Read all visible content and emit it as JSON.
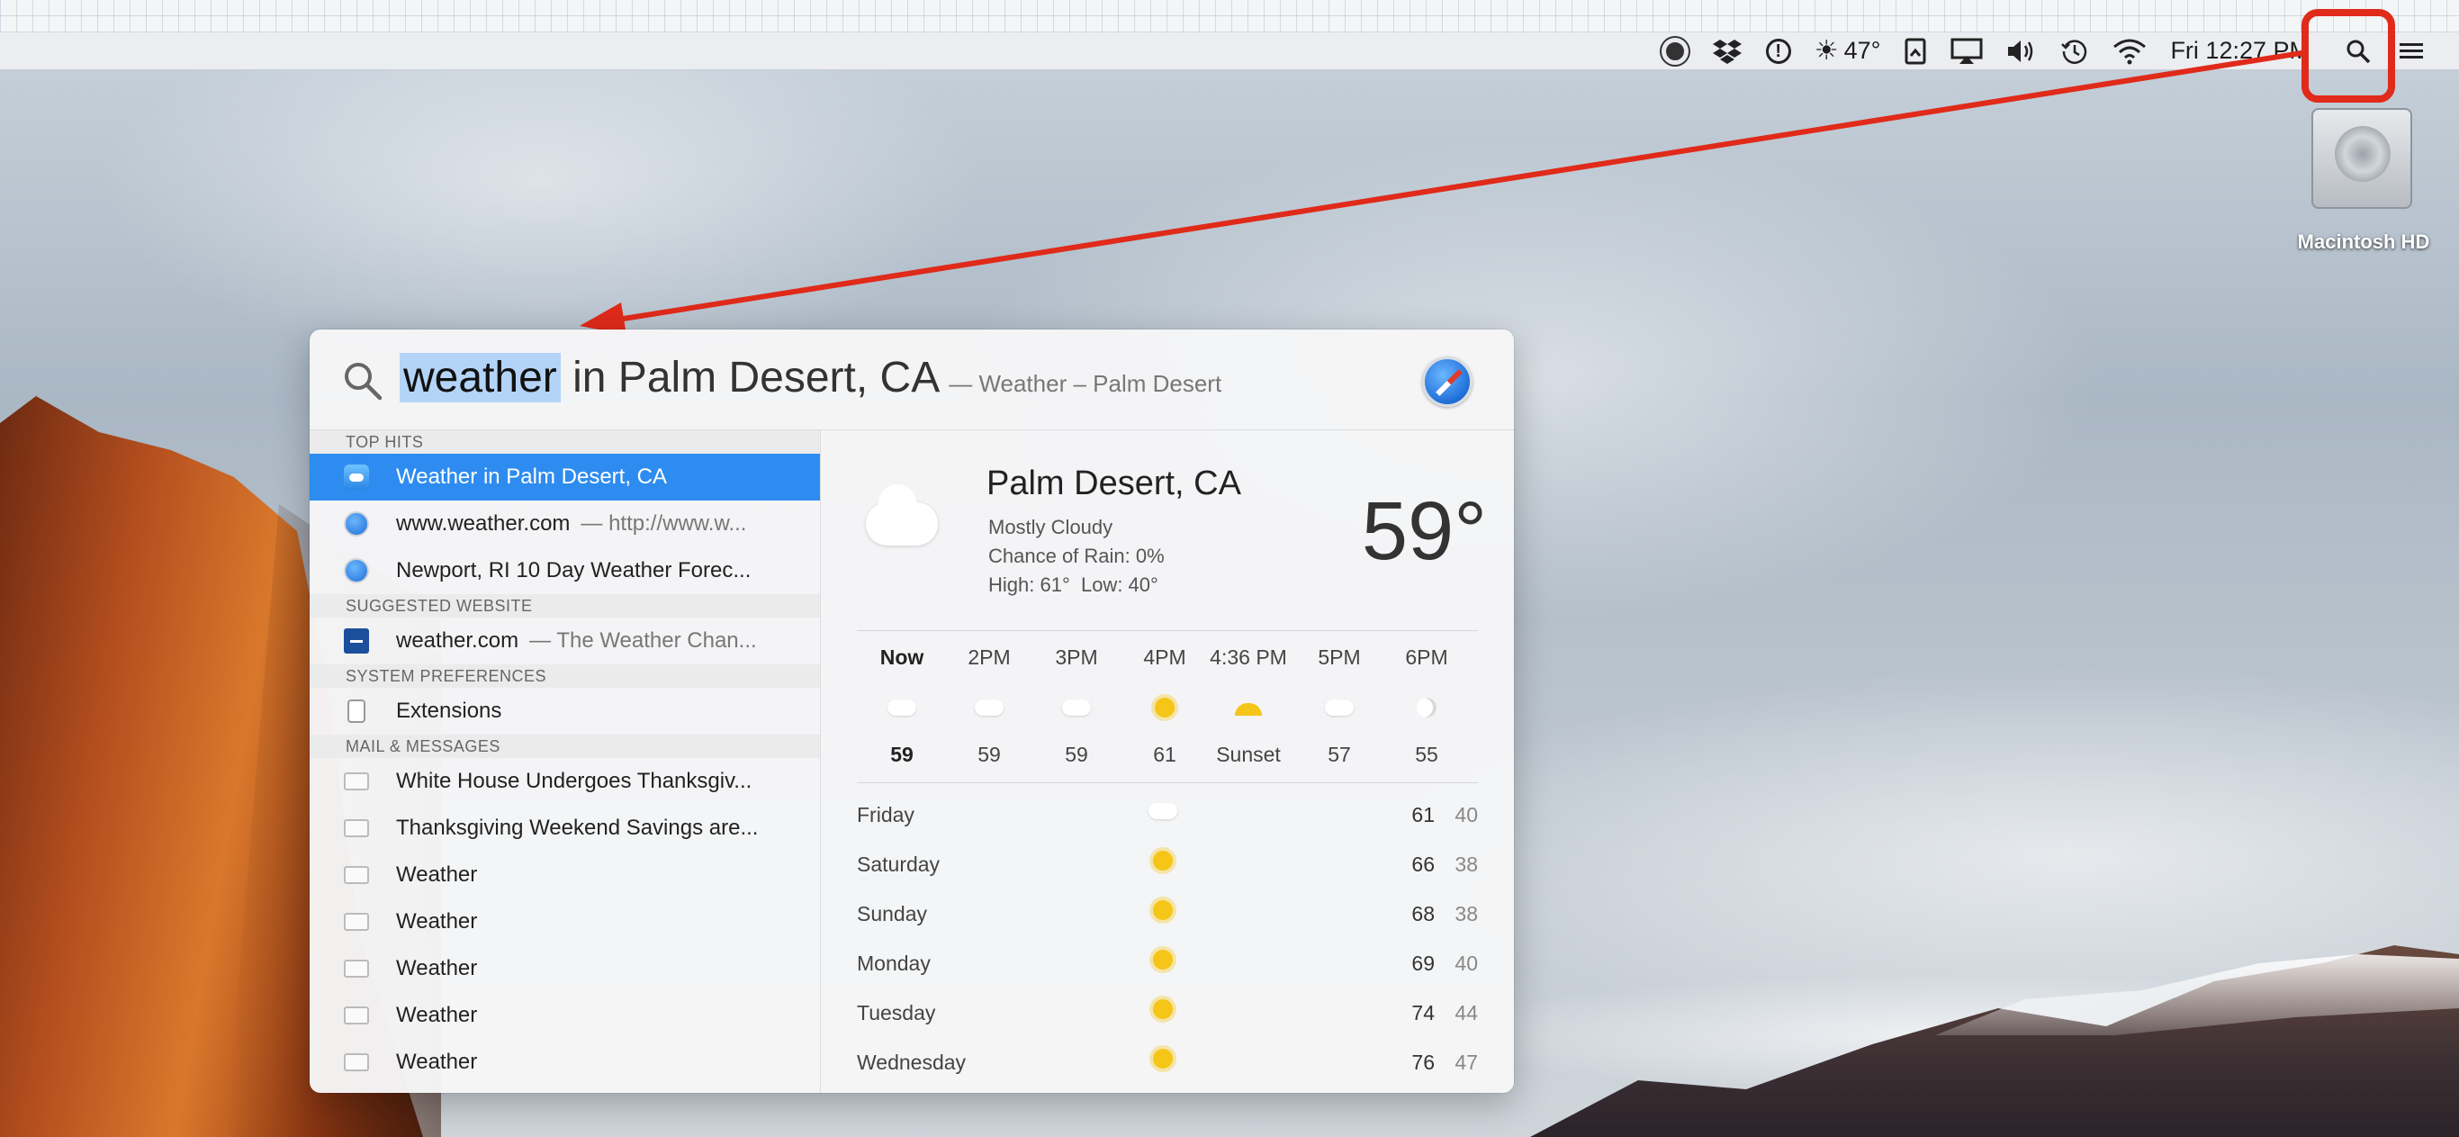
{
  "menubar": {
    "weather_temp": "47°",
    "clock": "Fri 12:27 PM",
    "items": [
      "record-icon",
      "dropbox-icon",
      "1password-icon",
      "weather-icon",
      "document-icon",
      "airplay-icon",
      "volume-icon",
      "time-machine-icon",
      "wifi-icon",
      "clock",
      "spotlight-search-icon",
      "notification-center-icon"
    ]
  },
  "desktop": {
    "drive_label": "Macintosh HD"
  },
  "spotlight": {
    "query_highlight": "weather",
    "query_rest": " in Palm Desert, CA",
    "query_hint": "— Weather – Palm Desert",
    "sections": {
      "top_hits": "TOP HITS",
      "suggested_website": "SUGGESTED WEBSITE",
      "system_preferences": "SYSTEM PREFERENCES",
      "mail_messages": "MAIL & MESSAGES"
    },
    "results": {
      "top_hits": [
        {
          "title": "Weather in Palm Desert, CA",
          "secondary": "",
          "icon": "weather-app-icon"
        },
        {
          "title": "www.weather.com",
          "secondary": "— http://www.w...",
          "icon": "safari-icon"
        },
        {
          "title": "Newport, RI 10 Day Weather Forec...",
          "secondary": "",
          "icon": "safari-icon"
        }
      ],
      "suggested_website": [
        {
          "title": "weather.com",
          "secondary": "— The Weather Chan...",
          "icon": "website-icon"
        }
      ],
      "system_preferences": [
        {
          "title": "Extensions",
          "secondary": "",
          "icon": "preference-pane-icon"
        }
      ],
      "mail_messages": [
        {
          "title": "White House Undergoes Thanksgiv...",
          "icon": "mail-icon"
        },
        {
          "title": "Thanksgiving Weekend Savings are...",
          "icon": "mail-icon"
        },
        {
          "title": "Weather",
          "icon": "mail-icon"
        },
        {
          "title": "Weather",
          "icon": "mail-icon"
        },
        {
          "title": "Weather",
          "icon": "mail-icon"
        },
        {
          "title": "Weather",
          "icon": "mail-icon"
        },
        {
          "title": "Weather",
          "icon": "mail-icon"
        }
      ]
    },
    "weather": {
      "city": "Palm Desert, CA",
      "condition": "Mostly Cloudy",
      "rain": "Chance of Rain: 0%",
      "high_low": "High: 61°  Low: 40°",
      "current_temp": "59°",
      "hourly": [
        {
          "time": "Now",
          "icon": "cloud",
          "temp": "59"
        },
        {
          "time": "2PM",
          "icon": "cloud",
          "temp": "59"
        },
        {
          "time": "3PM",
          "icon": "cloud",
          "temp": "59"
        },
        {
          "time": "4PM",
          "icon": "partly-sunny",
          "temp": "61"
        },
        {
          "time": "4:36 PM",
          "icon": "sunset",
          "temp": "Sunset"
        },
        {
          "time": "5PM",
          "icon": "partly-cloudy",
          "temp": "57"
        },
        {
          "time": "6PM",
          "icon": "moon",
          "temp": "55"
        }
      ],
      "daily": [
        {
          "day": "Friday",
          "icon": "cloud",
          "high": "61",
          "low": "40"
        },
        {
          "day": "Saturday",
          "icon": "sun",
          "high": "66",
          "low": "38"
        },
        {
          "day": "Sunday",
          "icon": "sun",
          "high": "68",
          "low": "38"
        },
        {
          "day": "Monday",
          "icon": "sun",
          "high": "69",
          "low": "40"
        },
        {
          "day": "Tuesday",
          "icon": "sun",
          "high": "74",
          "low": "44"
        },
        {
          "day": "Wednesday",
          "icon": "sun",
          "high": "76",
          "low": "47"
        }
      ]
    }
  },
  "colors": {
    "selection": "#2e8cf0",
    "annotation_red": "#e02a1a",
    "query_highlight": "#b4d4f7"
  }
}
